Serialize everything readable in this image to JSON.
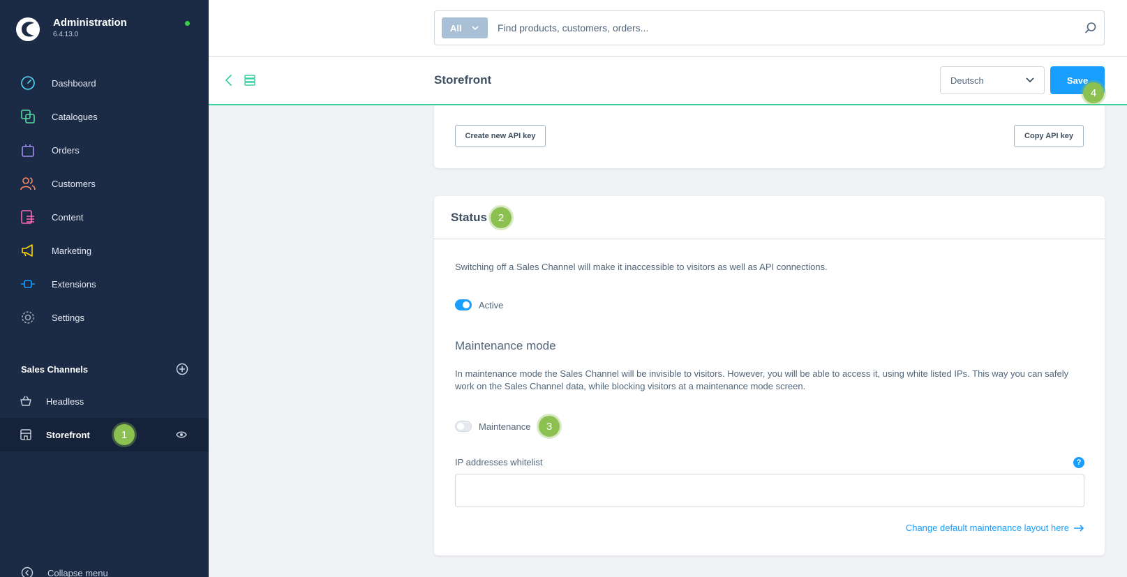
{
  "app": {
    "title": "Administration",
    "version": "6.4.13.0",
    "status_color": "#37d046"
  },
  "colors": {
    "sidebar_bg": "#1b2a45",
    "accent": "#189eff",
    "badge": "#8cc152",
    "smartbar_line": "#37d0a1"
  },
  "nav": {
    "items": [
      {
        "label": "Dashboard",
        "icon": "dashboard-icon",
        "color": "#57d9f5"
      },
      {
        "label": "Catalogues",
        "icon": "catalogue-icon",
        "color": "#57d9a3"
      },
      {
        "label": "Orders",
        "icon": "orders-bag-icon",
        "color": "#a092f0"
      },
      {
        "label": "Customers",
        "icon": "customers-icon",
        "color": "#f88962"
      },
      {
        "label": "Content",
        "icon": "content-icon",
        "color": "#ff68b4"
      },
      {
        "label": "Marketing",
        "icon": "megaphone-icon",
        "color": "#ffd700"
      },
      {
        "label": "Extensions",
        "icon": "plug-icon",
        "color": "#189eff"
      },
      {
        "label": "Settings",
        "icon": "gear-icon",
        "color": "#9aa8b5"
      }
    ]
  },
  "sales_channels": {
    "title": "Sales Channels",
    "items": [
      {
        "label": "Headless",
        "icon": "basket-icon"
      },
      {
        "label": "Storefront",
        "icon": "storefront-icon",
        "badge": "1"
      }
    ],
    "collapse_label": "Collapse menu"
  },
  "search": {
    "type_label": "All",
    "placeholder": "Find products, customers, orders..."
  },
  "smartbar": {
    "title": "Storefront",
    "language": "Deutsch",
    "save_label": "Save",
    "save_badge": "4"
  },
  "api_card": {
    "create_key_label": "Create new API key",
    "copy_key_label": "Copy API key"
  },
  "status_card": {
    "title": "Status",
    "title_badge": "2",
    "description": "Switching off a Sales Channel will make it inaccessible to visitors as well as API connections.",
    "active_label": "Active",
    "active_on": true,
    "maintenance_title": "Maintenance mode",
    "maintenance_desc": "In maintenance mode the Sales Channel will be invisible to visitors. However, you will be able to access it, using white listed IPs. This way you can safely work on the Sales Channel data, while blocking visitors at a maintenance mode screen.",
    "maintenance_label": "Maintenance",
    "maintenance_on": false,
    "maintenance_badge": "3",
    "ip_label": "IP addresses whitelist",
    "ip_value": "",
    "help_symbol": "?",
    "layout_link": "Change default maintenance layout here"
  }
}
